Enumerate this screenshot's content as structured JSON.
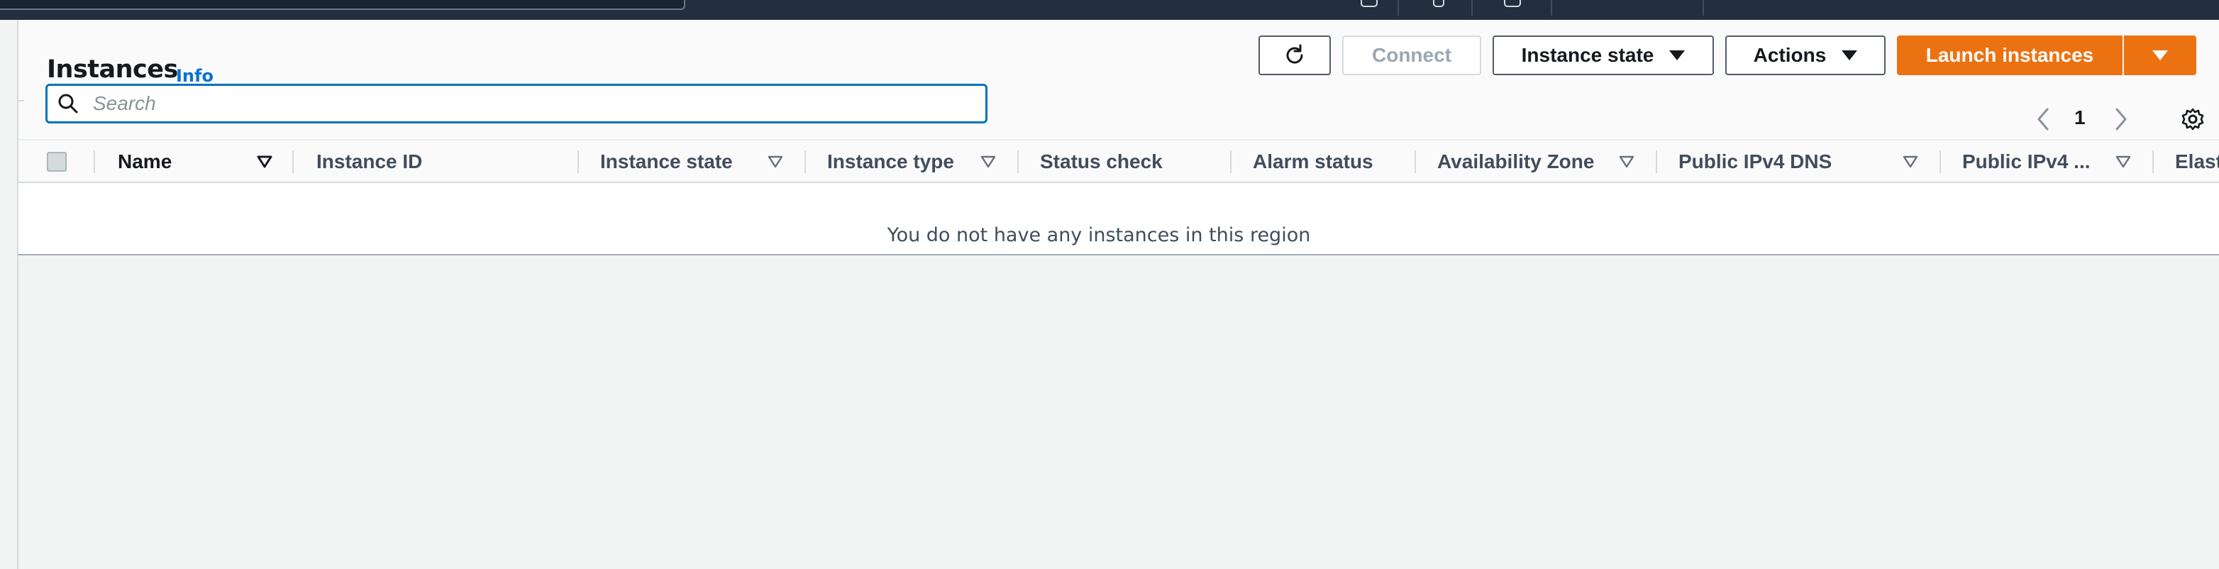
{
  "page": {
    "title": "Instances",
    "info_link": "Info"
  },
  "toolbar": {
    "refresh_icon": "refresh-icon",
    "connect_label": "Connect",
    "instance_state_label": "Instance state",
    "actions_label": "Actions",
    "launch_label": "Launch instances"
  },
  "search": {
    "placeholder": "Search",
    "value": ""
  },
  "pagination": {
    "current_page": "1"
  },
  "table": {
    "columns": [
      "Name",
      "Instance ID",
      "Instance state",
      "Instance type",
      "Status check",
      "Alarm status",
      "Availability Zone",
      "Public IPv4 DNS",
      "Public IPv4 ...",
      "Elast"
    ],
    "empty_message": "You do not have any instances in this region"
  },
  "colors": {
    "primary": "#ec7211",
    "link": "#0972d3",
    "focus": "#0073bb",
    "topbar": "#232f3e"
  }
}
